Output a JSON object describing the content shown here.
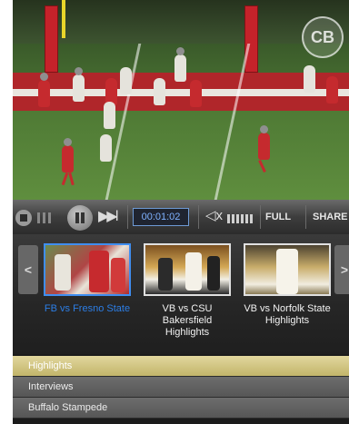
{
  "player": {
    "logo_text": "CB",
    "controls": {
      "time": "00:01:02",
      "full_label": "FULL",
      "share_label": "SHARE",
      "icons": {
        "stop": "stop-icon",
        "previous": "previous-icon",
        "pause": "pause-icon",
        "next": "next-icon",
        "volume": "volume-muted-icon"
      }
    }
  },
  "carousel": {
    "left_arrow": "<",
    "right_arrow": ">",
    "items": [
      {
        "label": "FB vs Fresno State",
        "active": true
      },
      {
        "label": "VB vs CSU Bakersfield Highlights",
        "active": false
      },
      {
        "label": "VB vs Norfolk State Highlights",
        "active": false
      }
    ]
  },
  "menu": {
    "items": [
      {
        "label": "Highlights",
        "active": true
      },
      {
        "label": "Interviews",
        "active": false
      },
      {
        "label": "Buffalo Stampede",
        "active": false
      }
    ]
  },
  "colors": {
    "accent_blue": "#2c7ee6",
    "active_menu_gold": "#c2b56a",
    "field_red": "#b0262a"
  }
}
